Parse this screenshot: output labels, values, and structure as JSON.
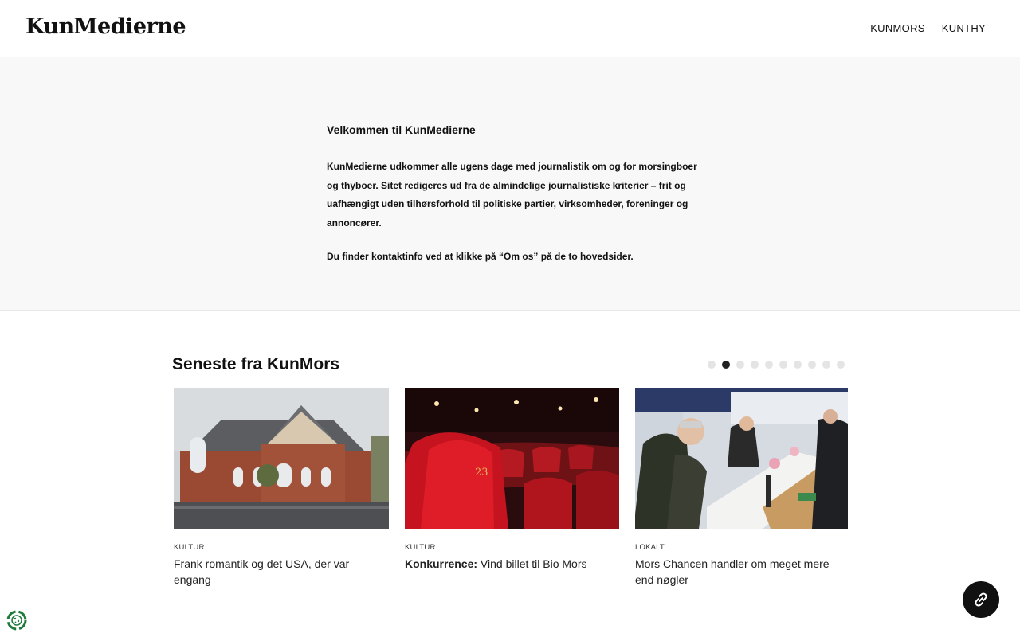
{
  "header": {
    "logo": "KunMedierne",
    "nav": [
      {
        "label": "KUNMORS"
      },
      {
        "label": "KUNTHY"
      }
    ]
  },
  "intro": {
    "heading": "Velkommen til KunMedierne",
    "paragraph1": "KunMedierne udkommer alle ugens dage med journalistik om og for morsingboer og thyboer. Sitet redigeres ud fra de almindelige journalistiske kriterier – frit og uafhængigt uden tilhørsforhold til politiske partier, virksomheder, foreninger og annoncører.",
    "paragraph2": "Du finder kontaktinfo ved at klikke på “Om os” på de to hovedsider."
  },
  "latest": {
    "title": "Seneste fra KunMors",
    "slider": {
      "count": 10,
      "active_index": 1
    },
    "articles": [
      {
        "category": "KULTUR",
        "title": "Frank romantik og det USA, der var engang",
        "title_prefix": ""
      },
      {
        "category": "KULTUR",
        "title_prefix": "Konkurrence:",
        "title": " Vind billet til Bio Mors"
      },
      {
        "category": "LOKALT",
        "title": "Mors Chancen handler om meget mere end nøgler",
        "title_prefix": ""
      }
    ]
  },
  "icons": {
    "floating_button": "link-icon",
    "cookie": "cookie-icon"
  },
  "colors": {
    "accent": "#111111",
    "intro_bg": "#f8f8f8",
    "cookie_green": "#1e7a3a"
  }
}
